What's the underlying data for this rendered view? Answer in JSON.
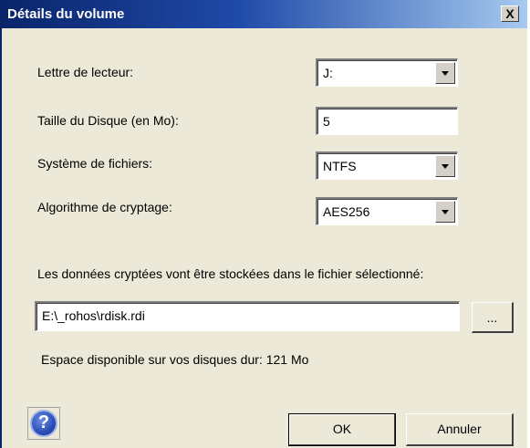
{
  "window": {
    "title": "Détails du volume",
    "close_label": "X"
  },
  "form": {
    "drive_letter_label": "Lettre de lecteur:",
    "drive_letter_value": "J:",
    "disk_size_label": "Taille du Disque (en Mo):",
    "disk_size_value": "5",
    "filesystem_label": "Système de fichiers:",
    "filesystem_value": "NTFS",
    "algorithm_label": "Algorithme de cryptage:",
    "algorithm_value": "AES256",
    "storage_info": "Les données cryptées vont être stockées dans le fichier sélectionné:",
    "file_path": "E:\\_rohos\\rdisk.rdi",
    "browse_label": "...",
    "space_info": "Espace disponible sur vos disques dur:  121 Mo"
  },
  "buttons": {
    "help_label": "?",
    "ok_label": "OK",
    "cancel_label": "Annuler"
  }
}
